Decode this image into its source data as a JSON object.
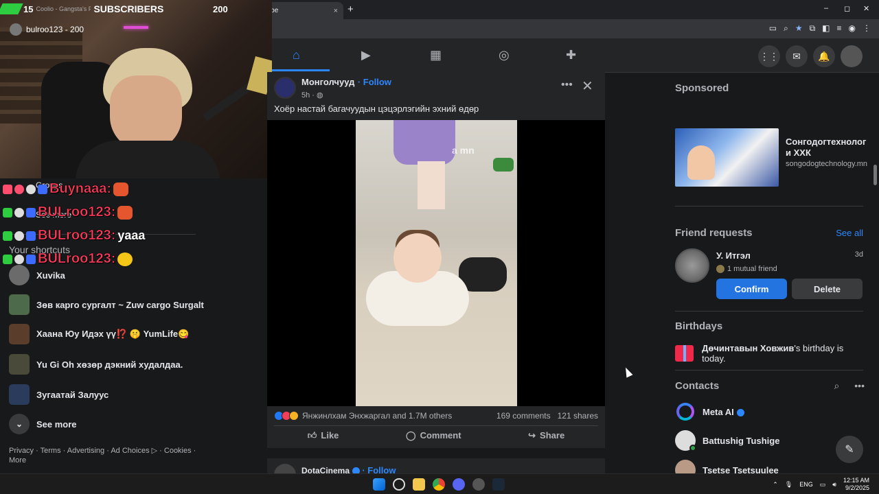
{
  "browser": {
    "tab_title": "YouTube",
    "tab_close": "×",
    "new_tab": "+",
    "win_min": "–",
    "win_max": "◻",
    "win_close": "✕"
  },
  "stream": {
    "sub_goal": "15",
    "ghost_tab": "Coolio - Gangsta's Paradise (feat. L.V.) [Official Music Video]",
    "sub_label": "SUBSCRIBERS",
    "sub_count": "200",
    "cam_user": "bulroo123 - 200",
    "chat": [
      {
        "name": "Buynaaa:",
        "msg": ""
      },
      {
        "name": "BULroo123:",
        "msg": ""
      },
      {
        "name": "BULroo123:",
        "msg": "yaaa"
      },
      {
        "name": "BULroo123:",
        "msg": ""
      }
    ]
  },
  "nav": {
    "home": "⌂",
    "video": "▶",
    "marketplace": "▦",
    "groups": "◎",
    "gaming": "✚",
    "menu": "⋮⋮",
    "messenger": "✉",
    "notifications": "🔔"
  },
  "sidebar": {
    "ghost_groups": "Groups",
    "ghost_see_more": "See more",
    "shortcuts_title": "Your shortcuts",
    "shortcuts": [
      {
        "label": "Xuvika"
      },
      {
        "label": "Зөв карго сургалт ~ Zuw cargo Surgalt"
      },
      {
        "label": "Хаана Юу Идэх үү⁉️ 🤫 YumLife😋"
      },
      {
        "label": "Yu Gi Oh хөзөр дэкний худалдаа."
      },
      {
        "label": "Зугаатай Залуус"
      }
    ],
    "see_more": "See more",
    "footer": "Privacy · Terms · Advertising · Ad Choices ▷ · Cookies · More"
  },
  "post": {
    "author": "Монголчууд",
    "follow": "· Follow",
    "time": "5h ·",
    "more": "•••",
    "close": "✕",
    "text": "Хоёр настай багачуудын цэцэрлэгийн эхний өдөр",
    "watermark": "a mn",
    "reactions_names": "Янжинлхам Энхжаргал and 1.7M others",
    "comments": "169 comments",
    "shares": "121 shares",
    "like": "Like",
    "comment": "Comment",
    "share": "Share"
  },
  "post2": {
    "author": "DotaCinema",
    "follow": "· Follow"
  },
  "right": {
    "sponsored": "Sponsored",
    "ad_name": "Сонгодогтехнолог и ХХК",
    "ad_url": "songodogtechnology.mn",
    "friend_requests": "Friend requests",
    "see_all": "See all",
    "fr_name": "У. Итгэл",
    "fr_age": "3d",
    "fr_mutual": "1 mutual friend",
    "confirm": "Confirm",
    "delete": "Delete",
    "birthdays": "Birthdays",
    "bday_name": "Дөчинтавын Ховжив",
    "bday_rest": "'s birthday is today.",
    "contacts": "Contacts",
    "contact_list": [
      {
        "name": "Meta AI"
      },
      {
        "name": "Battushig Tushige"
      },
      {
        "name": "Tsetse Tsetsuulee"
      }
    ]
  },
  "taskbar": {
    "lang": "ENG",
    "time": "12:15 AM",
    "date": "9/2/2025"
  }
}
